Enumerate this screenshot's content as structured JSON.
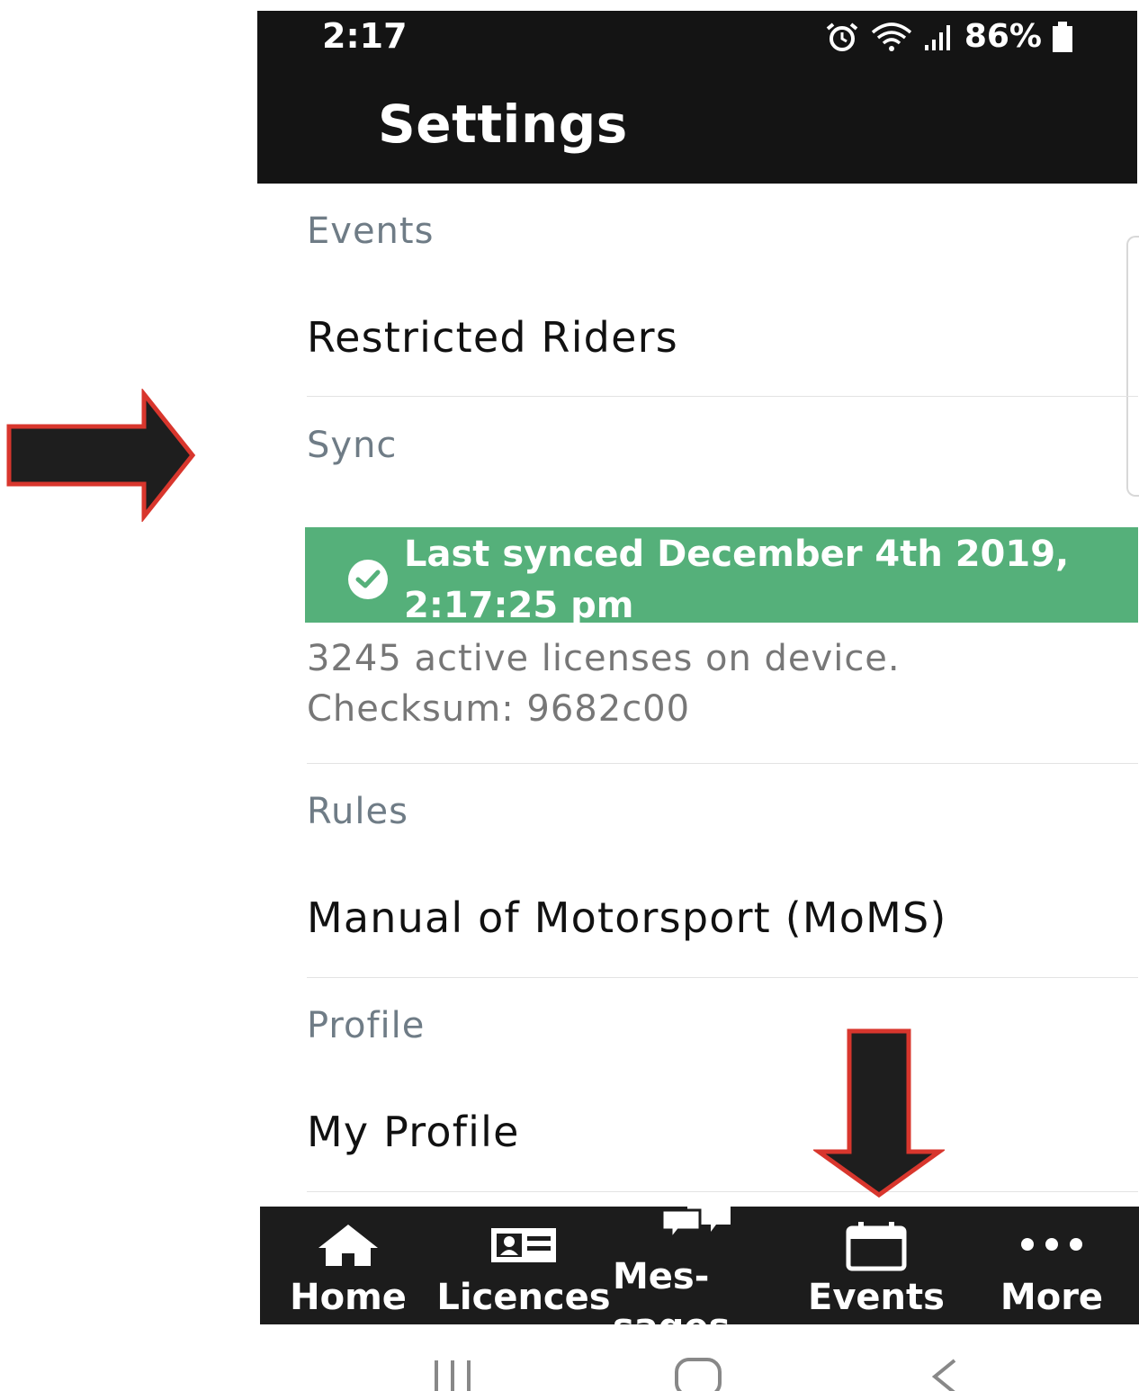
{
  "status_bar": {
    "time": "2:17",
    "battery": "86%",
    "icons": [
      "alarm-icon",
      "wifi-icon",
      "signal-icon",
      "battery-icon"
    ]
  },
  "header": {
    "title": "Settings"
  },
  "sections": {
    "events": {
      "label": "Events",
      "item": "Restricted Riders"
    },
    "sync": {
      "label": "Sync",
      "banner_line1": "Last synced December 4th 2019,",
      "banner_line2": "2:17:25 pm",
      "info_line1": "3245 active licenses on device.",
      "info_line2": "Checksum: 9682c00"
    },
    "rules": {
      "label": "Rules",
      "item": "Manual of Motorsport (MoMS)"
    },
    "profile": {
      "label": "Profile",
      "item": "My Profile"
    }
  },
  "tabs": [
    {
      "label": "Home",
      "icon": "home-icon"
    },
    {
      "label": "Licences",
      "icon": "id-card-icon"
    },
    {
      "label": "Mes-\nsages",
      "icon": "chat-bubbles-icon"
    },
    {
      "label": "Events",
      "icon": "calendar-icon"
    },
    {
      "label": "More",
      "icon": "more-dots-icon"
    }
  ],
  "colors": {
    "header_bg": "#141414",
    "sync_green": "#55b07a",
    "section_label": "#6f7c86",
    "arrow_red": "#d8362d",
    "arrow_fill": "#1e1e1e"
  }
}
